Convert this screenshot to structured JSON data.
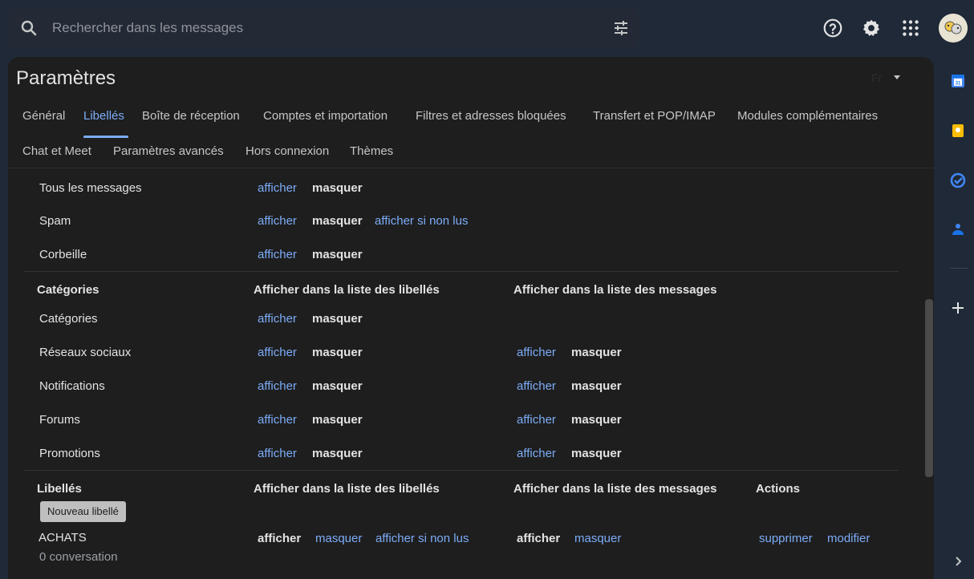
{
  "search": {
    "placeholder": "Rechercher dans les messages"
  },
  "header": {
    "title": "Paramètres",
    "lang": "Fr"
  },
  "tabs": [
    "Général",
    "Libellés",
    "Boîte de réception",
    "Comptes et importation",
    "Filtres et adresses bloquées",
    "Transfert et POP/IMAP",
    "Modules complémentaires",
    "Chat et Meet",
    "Paramètres avancés",
    "Hors connexion",
    "Thèmes"
  ],
  "active_tab": "Libellés",
  "system_rows": [
    {
      "label": "Tous les messages",
      "show": "afficher",
      "hide": "masquer"
    },
    {
      "label": "Spam",
      "show": "afficher",
      "hide": "masquer",
      "unread": "afficher si non lus"
    },
    {
      "label": "Corbeille",
      "show": "afficher",
      "hide": "masquer"
    }
  ],
  "categories": {
    "header": "Catégories",
    "col_labels": "Afficher dans la liste des libellés",
    "col_messages": "Afficher dans la liste des messages",
    "rows": [
      {
        "label": "Catégories",
        "show": "afficher",
        "hide": "masquer"
      },
      {
        "label": "Réseaux sociaux",
        "show": "afficher",
        "hide": "masquer",
        "msg_show": "afficher",
        "msg_hide": "masquer"
      },
      {
        "label": "Notifications",
        "show": "afficher",
        "hide": "masquer",
        "msg_show": "afficher",
        "msg_hide": "masquer"
      },
      {
        "label": "Forums",
        "show": "afficher",
        "hide": "masquer",
        "msg_show": "afficher",
        "msg_hide": "masquer"
      },
      {
        "label": "Promotions",
        "show": "afficher",
        "hide": "masquer",
        "msg_show": "afficher",
        "msg_hide": "masquer"
      }
    ]
  },
  "labels": {
    "header": "Libellés",
    "col_labels": "Afficher dans la liste des libellés",
    "col_messages": "Afficher dans la liste des messages",
    "col_actions": "Actions",
    "new_button": "Nouveau libellé",
    "rows": [
      {
        "name": "ACHATS",
        "count": "0 conversation",
        "show": "afficher",
        "hide": "masquer",
        "unread": "afficher si non lus",
        "msg_show": "afficher",
        "msg_hide": "masquer",
        "delete": "supprimer",
        "edit": "modifier"
      }
    ]
  },
  "icons": [
    "search-icon",
    "tune-icon",
    "help-icon",
    "settings-icon",
    "apps-icon",
    "calendar-icon",
    "keep-icon",
    "tasks-icon",
    "contacts-icon",
    "plus-icon",
    "chevron-right-icon"
  ],
  "colors": {
    "link": "#7cacf8",
    "background": "#1e1e1e",
    "topbar": "#1f2937"
  }
}
